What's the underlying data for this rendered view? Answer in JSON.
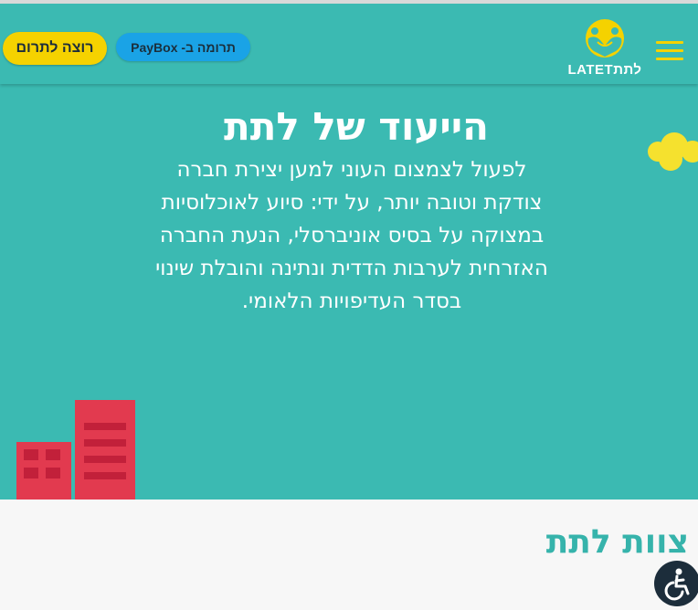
{
  "header": {
    "donate_label": "רוצה לתרום",
    "paybox_label": "תרומה ב- PayBox",
    "logo_text": "LATETלתת",
    "menu_icon": "hamburger-icon"
  },
  "mission": {
    "title": "הייעוד של לתת",
    "text": "לפעול לצמצום העוני למען יצירת חברה צודקת וטובה יותר, על ידי: סיוע לאוכלוסיות במצוקה על בסיס אוניברסלי, הנעת החברה האזרחית לערבות הדדית ונתינה והובלת שינוי בסדר העדיפויות הלאומי."
  },
  "team": {
    "title": "צוות לתת"
  },
  "accessibility": {
    "icon": "accessibility-icon"
  },
  "colors": {
    "primary": "#3bbab2",
    "accent": "#f5d200",
    "paybox": "#1aa3e6",
    "building": "#e23a4f",
    "dark": "#1c2d3b"
  }
}
